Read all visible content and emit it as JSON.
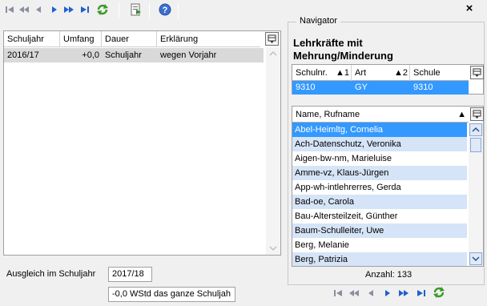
{
  "left_grid": {
    "headers": [
      "Schuljahr",
      "Umfang",
      "Dauer",
      "Erklärung"
    ],
    "rows": [
      [
        "2016/17",
        "+0,0",
        "Schuljahr",
        "wegen Vorjahr"
      ]
    ]
  },
  "ausgleich": {
    "label": "Ausgleich im Schuljahr",
    "value": "2017/18",
    "note": "-0,0 WStd das ganze Schuljah"
  },
  "navigator": {
    "title": "Navigator",
    "heading_line1": "Lehrkräfte mit",
    "heading_line2": "Mehrung/Minderung",
    "school_headers": [
      "Schulnr.",
      "1",
      "Art",
      "2",
      "Schule"
    ],
    "school_row": [
      "9310",
      "GY",
      "9310"
    ],
    "list_header": "Name, Rufname",
    "names": [
      "Abel-Heimltg, Cornelia",
      "Ach-Datenschutz, Veronika",
      "Aigen-bw-nm, Marieluise",
      "Amme-vz, Klaus-Jürgen",
      "App-wh-intlehrerres, Gerda",
      "Bad-oe, Carola",
      "Bau-Altersteilzeit, Günther",
      "Baum-Schulleiter, Uwe",
      "Berg, Melanie",
      "Berg, Patrizia"
    ],
    "count_label": "Anzahl: 133"
  },
  "colors": {
    "selection": "#3399ff",
    "alt_row": "#d6e4f7",
    "white_row": "#ffffff",
    "nav_blue": "#1f5fcf",
    "green_refresh": "#3a9a2a"
  }
}
